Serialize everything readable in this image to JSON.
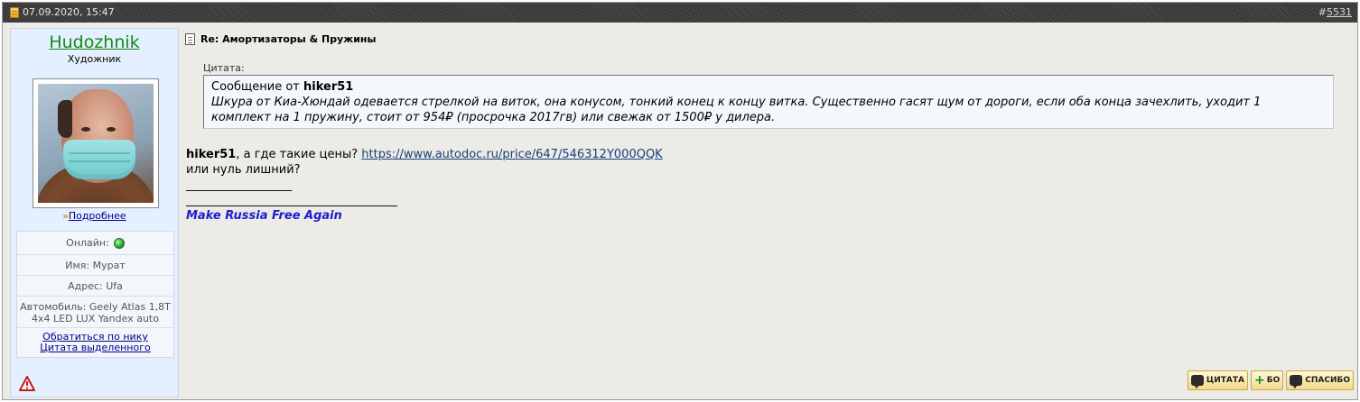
{
  "header": {
    "date": "07.09.2020, 15:47",
    "post_number": "5531",
    "post_number_prefix": "#"
  },
  "user": {
    "name": "Hudozhnik",
    "title": "Художник",
    "more_link": "Подробнее",
    "online_label": "Онлайн:",
    "name_field": "Имя: Мурат",
    "address_field": "Адрес: Ufa",
    "car_field_line1": "Автомобиль: Geely Atlas 1,8T",
    "car_field_line2": "4x4 LED LUX Yandex auto",
    "mention_link": "Обратиться по нику",
    "quote_selected_link": "Цитата выделенного"
  },
  "post": {
    "title": "Re: Амортизаторы & Пружины",
    "quote_label": "Цитата:",
    "quote_prefix": "Сообщение от",
    "quote_author": "hiker51",
    "quote_text_line1": "Шкура от Киа-Хюндай одевается стрелкой на виток, она конусом, тонкий конец к концу витка. Существенно гасят щум от дороги, если оба конца зачехлить, уходит 1",
    "quote_text_line2": "комплект на 1 пружину, стоит от 954₽ (просрочка 2017гв) или свежак от 1500₽ у дилера.",
    "reply_author": "hiker51",
    "reply_text": ", а где такие цены? ",
    "reply_link": "https://www.autodoc.ru/price/647/546312Y000QQK",
    "reply_text2": "или нуль лишний?",
    "signature_line1": "__________________",
    "signature_line2": "____________________________________",
    "signature_slogan": "Make Russia Free Again"
  },
  "buttons": {
    "quote": "ЦИТАТА",
    "multiquote": "БО",
    "thanks": "СПАСИБО"
  },
  "colors": {
    "username": "#148c14",
    "slogan": "#1d1dcf",
    "link": "#1a3f7a"
  }
}
